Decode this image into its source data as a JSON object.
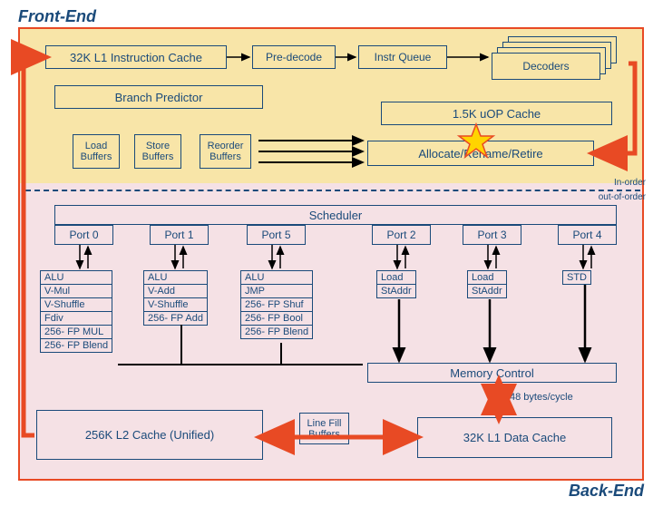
{
  "titles": {
    "frontend": "Front-End",
    "backend": "Back-End"
  },
  "l1i": "32K L1 Instruction Cache",
  "predecode": "Pre-decode",
  "instr_queue": "Instr Queue",
  "decoders": "Decoders",
  "branch_pred": "Branch Predictor",
  "uop_cache": "1.5K uOP Cache",
  "buffers": {
    "load": "Load\nBuffers",
    "store": "Store\nBuffers",
    "reorder": "Reorder\nBuffers"
  },
  "arr": "Allocate/Rename/Retire",
  "scheduler": "Scheduler",
  "ports": [
    "Port 0",
    "Port 1",
    "Port 5",
    "Port 2",
    "Port 3",
    "Port 4"
  ],
  "units": {
    "p0": [
      "ALU",
      "V-Mul",
      "V-Shuffle",
      "Fdiv",
      "256- FP MUL",
      "256- FP Blend"
    ],
    "p1": [
      "ALU",
      "V-Add",
      "V-Shuffle",
      "256- FP Add"
    ],
    "p5": [
      "ALU",
      "JMP",
      "256- FP Shuf",
      "256- FP Bool",
      "256- FP Blend"
    ],
    "p2": [
      "Load",
      "StAddr"
    ],
    "p3": [
      "Load",
      "StAddr"
    ],
    "p4": [
      "STD"
    ]
  },
  "mem_ctrl": "Memory Control",
  "l2": "256K L2 Cache (Unified)",
  "lfb": "Line Fill\nBuffers",
  "l1d": "32K L1 Data Cache",
  "bw": "48 bytes/cycle",
  "order": {
    "in": "In-order",
    "out": "out-of-order"
  }
}
